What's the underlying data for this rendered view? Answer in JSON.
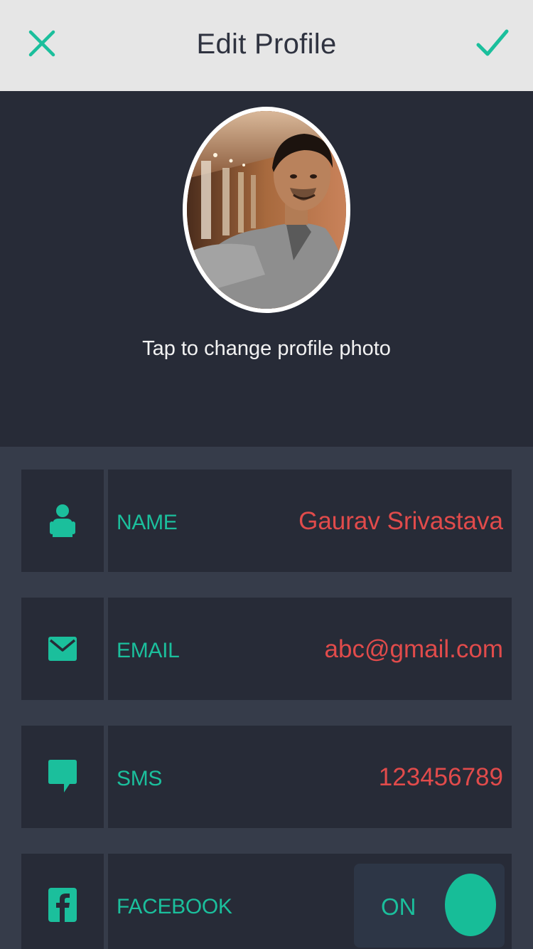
{
  "nav": {
    "title": "Edit Profile",
    "close_icon": "close-icon",
    "save_icon": "checkmark-icon"
  },
  "profile": {
    "change_photo_label": "Tap to change profile photo"
  },
  "fields": [
    {
      "icon": "person-icon",
      "label": "NAME",
      "value": "Gaurav Srivastava"
    },
    {
      "icon": "envelope-icon",
      "label": "EMAIL",
      "value": "abc@gmail.com"
    },
    {
      "icon": "chat-bubble-icon",
      "label": "SMS",
      "value": "123456789"
    },
    {
      "icon": "facebook-icon",
      "label": "FACEBOOK",
      "toggle": {
        "text": "ON",
        "enabled": true
      }
    }
  ],
  "colors": {
    "accent": "#1bbf9c",
    "value_text": "#e14b4b",
    "nav_bg": "#e6e6e6",
    "panel_bg": "#272b37",
    "page_bg": "#363c4a"
  }
}
